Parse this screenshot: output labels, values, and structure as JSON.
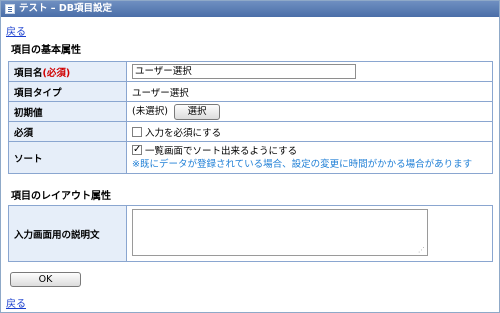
{
  "window": {
    "title": "テスト – DB項目設定",
    "icon": "app-window-icon"
  },
  "nav": {
    "back_top": "戻る",
    "back_bottom": "戻る"
  },
  "sections": {
    "basic": "項目の基本属性",
    "layout": "項目のレイアウト属性"
  },
  "fields": {
    "name_label": "項目名",
    "required_mark": "(必須)",
    "name_value": "ユーザー選択",
    "type_label": "項目タイプ",
    "type_value": "ユーザー選択",
    "initial_label": "初期値",
    "initial_value": "(未選択)",
    "select_button": "選択",
    "required_label": "必須",
    "required_checkbox_label": "入力を必須にする",
    "required_checked": false,
    "sort_label": "ソート",
    "sort_checkbox_label": "一覧画面でソート出来るようにする",
    "sort_checked": true,
    "sort_note": "※既にデータが登録されている場合、設定の変更に時間がかかる場合があります",
    "description_label": "入力画面用の説明文",
    "description_value": ""
  },
  "actions": {
    "ok": "OK"
  },
  "colors": {
    "link": "#1a3fcf",
    "required": "#d00000",
    "note": "#1f7fd6",
    "label_bg": "#e6eef9",
    "border": "#8aa6d0"
  }
}
